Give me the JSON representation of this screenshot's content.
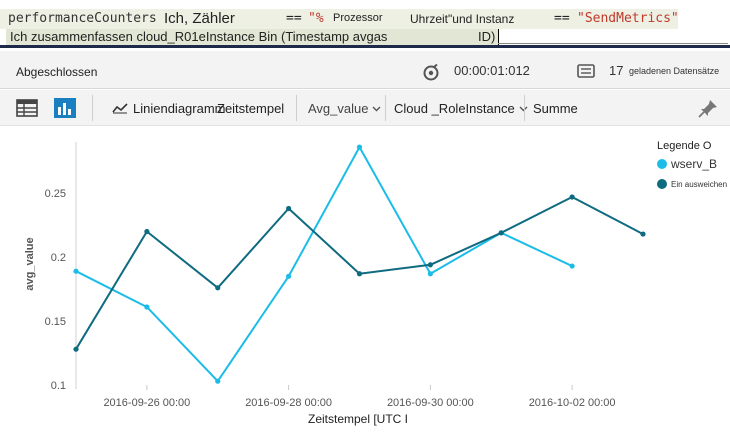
{
  "query": {
    "line1": {
      "table": "performanceCounters",
      "column": "Ich, Zähler",
      "op1": "==",
      "str1_open": "\"%",
      "word1": "Prozessor",
      "word2": "Uhrzeit\"und Instanz",
      "op2": "==",
      "str2": "\"SendMetrics\""
    },
    "line2": {
      "text": "Ich zusammenfassen cloud_R01eInstance Bin (Timestamp avgas",
      "tail": "ID)"
    }
  },
  "status": {
    "state": "Abgeschlossen",
    "elapsed": "00:00:01:012",
    "record_count": "17",
    "record_label": "geladenen Datensätze"
  },
  "toolbar": {
    "line_chart_label": "Liniendiagramm",
    "x_field": "Zeitstempel",
    "y_field": "Avg_value",
    "split_field": "Cloud _RoleInstance",
    "aggregate": "Summe"
  },
  "colors": {
    "series_a": "#1bbde8",
    "series_b": "#0f6b80",
    "accent": "#1a7fc0"
  },
  "chart_data": {
    "type": "line",
    "xlabel": "Zeitstempel [UTC I",
    "ylabel": "avg_value",
    "x_ticks": [
      "2016-09-26 00:00",
      "2016-09-28 00:00",
      "2016-09-30 00:00",
      "2016-10-02 00:00"
    ],
    "y_ticks": [
      "0.1",
      "0.15",
      "0.2",
      "0.25"
    ],
    "ylim": [
      0.1,
      0.29
    ],
    "legend_title": "Legende O",
    "legend_position": "top-right",
    "x": [
      "2016-09-25",
      "2016-09-26",
      "2016-09-27",
      "2016-09-28",
      "2016-09-29",
      "2016-09-30",
      "2016-10-01",
      "2016-10-02",
      "2016-10-03"
    ],
    "series": [
      {
        "name": "wserv_B",
        "values": [
          0.189,
          0.161,
          0.103,
          0.185,
          0.286,
          0.187,
          0.219,
          0.193,
          null
        ]
      },
      {
        "name": "Ein ausweichen",
        "values": [
          0.128,
          0.22,
          0.176,
          0.238,
          0.187,
          0.194,
          0.219,
          0.247,
          0.218
        ]
      }
    ]
  }
}
